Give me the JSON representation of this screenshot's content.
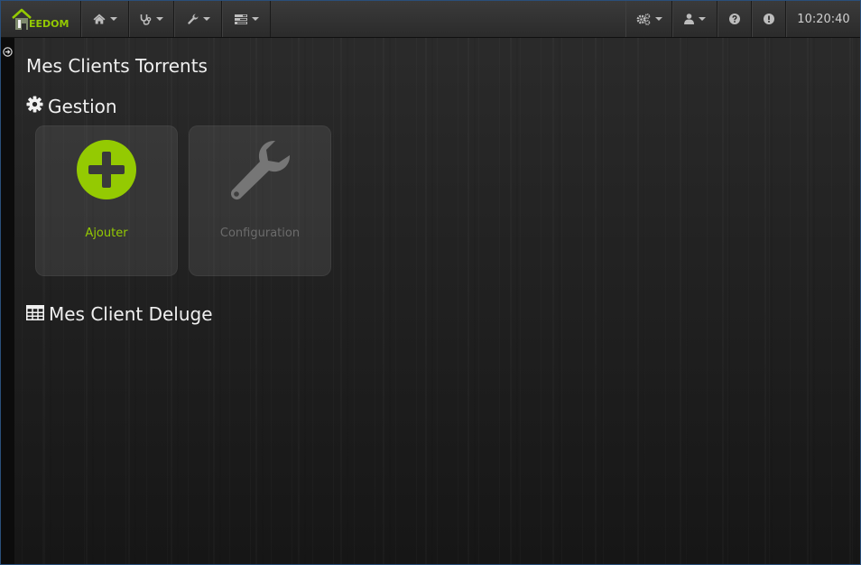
{
  "brand": {
    "name": "EEDOM",
    "logo_icon": "house-logo-icon",
    "accent_color": "#94ca02"
  },
  "navbar": {
    "left_menus": [
      {
        "icon": "home-icon"
      },
      {
        "icon": "stethoscope-icon"
      },
      {
        "icon": "wrench-icon"
      },
      {
        "icon": "tasks-icon"
      }
    ],
    "right_menus": [
      {
        "icon": "cogs-icon"
      },
      {
        "icon": "user-icon"
      },
      {
        "icon": "question-circle-icon"
      },
      {
        "icon": "exclamation-circle-icon"
      }
    ],
    "clock": "10:20:40"
  },
  "page": {
    "title": "Mes Clients Torrents"
  },
  "gestion": {
    "title": "Gestion",
    "icon": "cog-icon",
    "cards": [
      {
        "label": "Ajouter",
        "icon": "plus-circle-icon",
        "color": "#94ca02"
      },
      {
        "label": "Configuration",
        "icon": "wrench-icon",
        "color": "#767676"
      }
    ]
  },
  "equipments": {
    "title": "Mes Client Deluge",
    "icon": "table-icon"
  }
}
